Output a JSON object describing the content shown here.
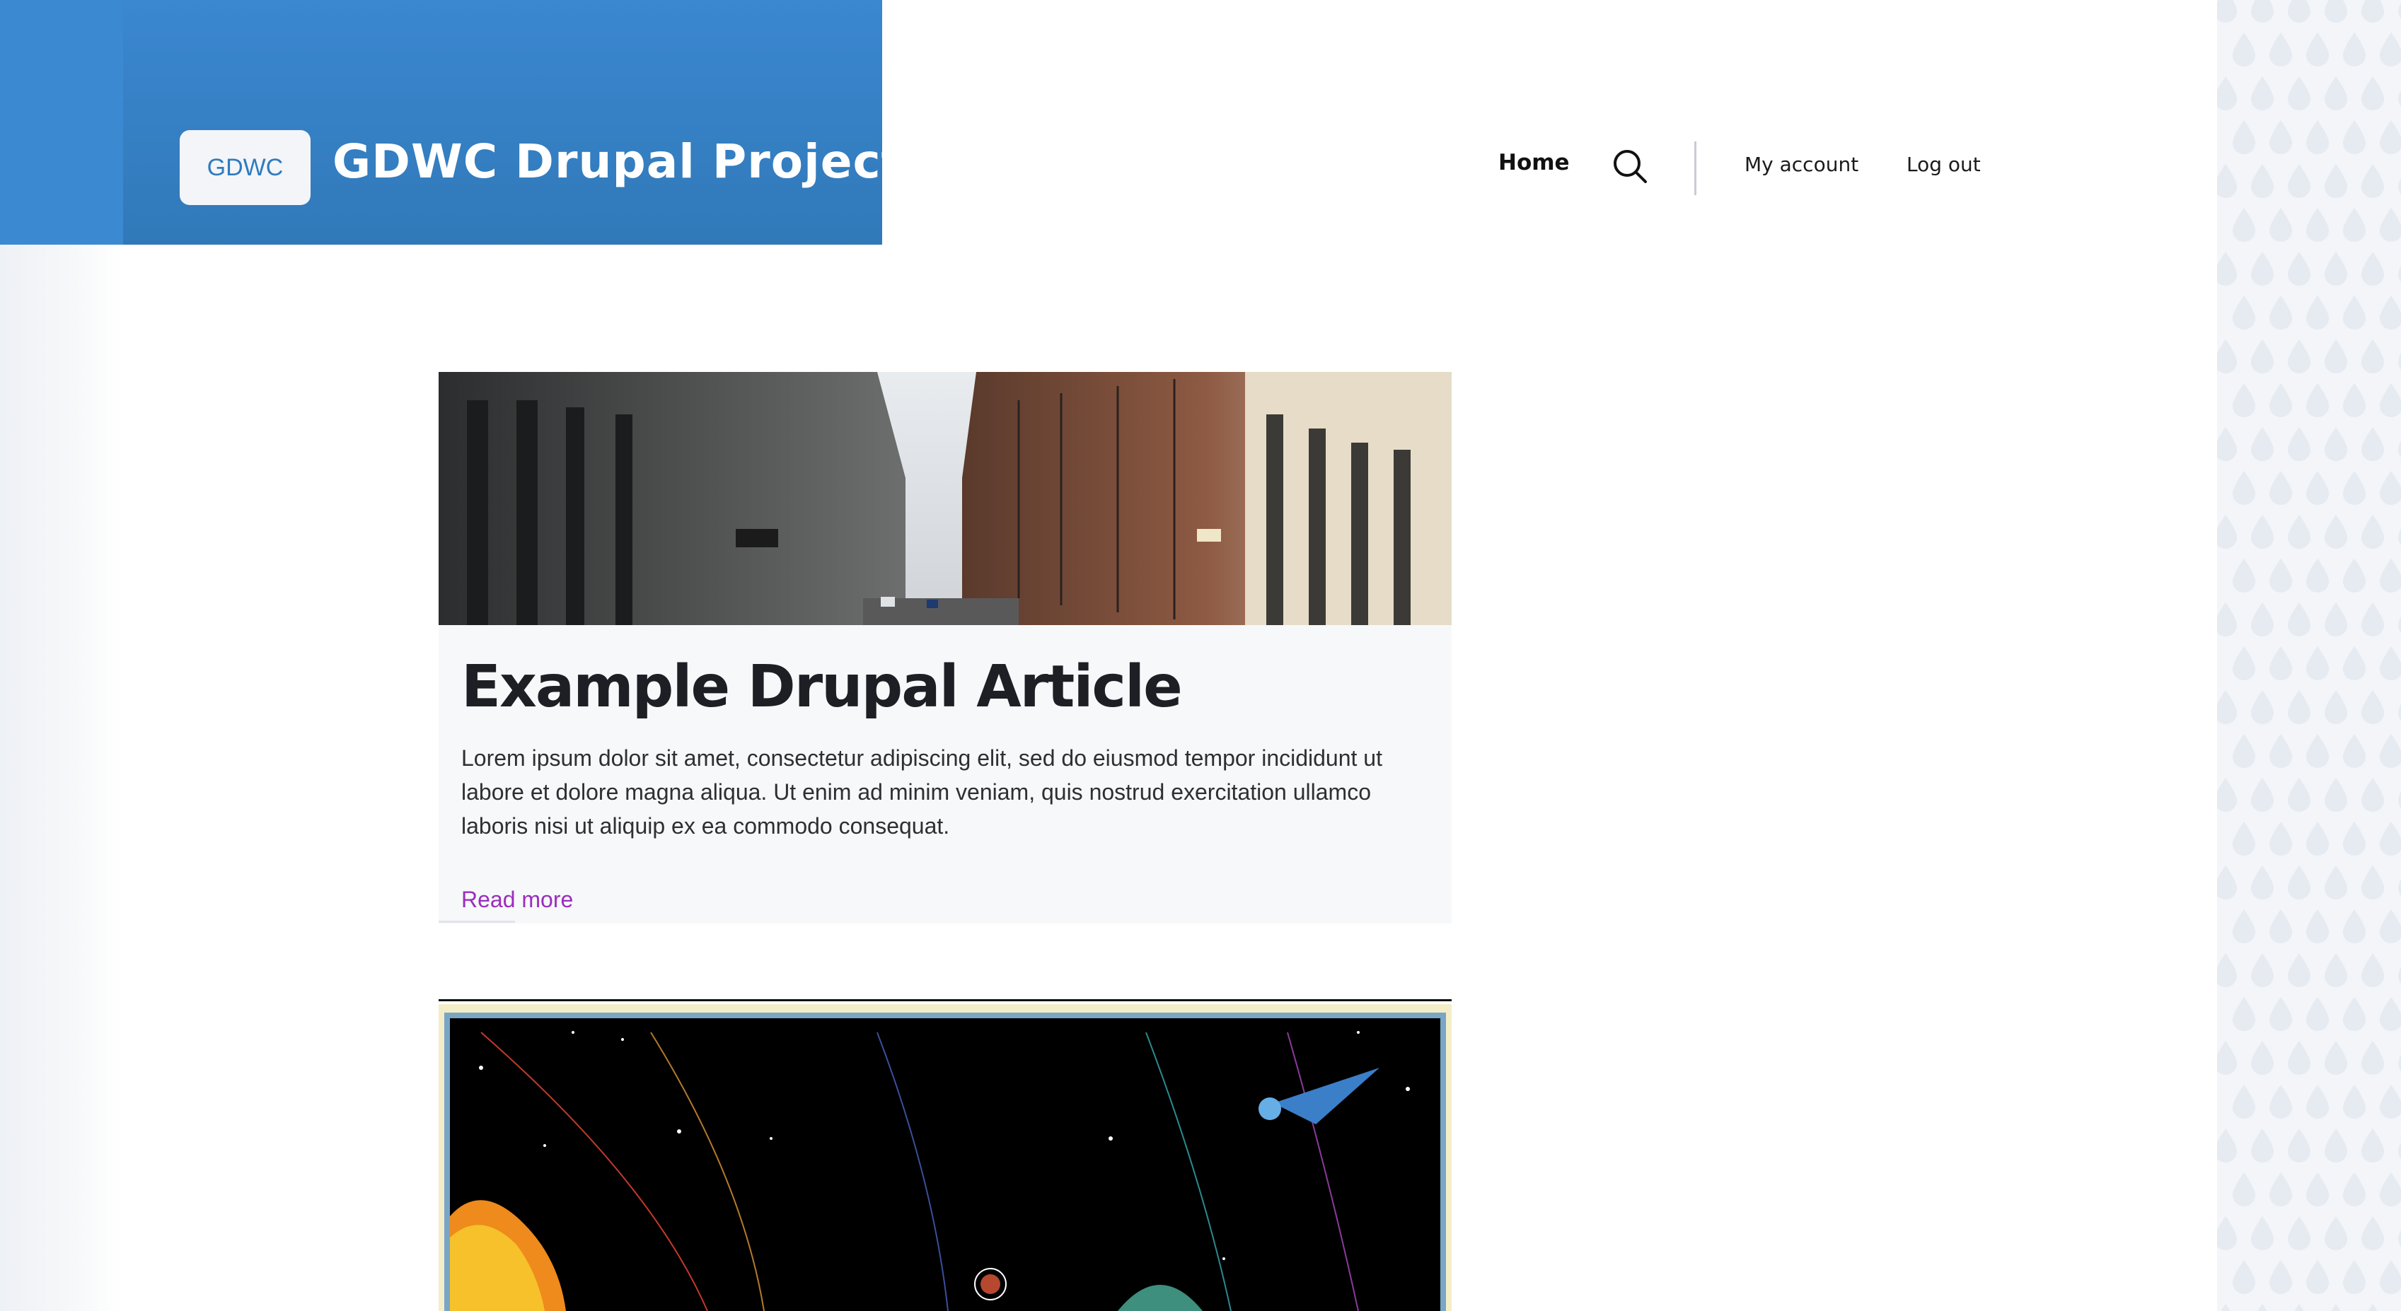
{
  "header": {
    "logo_text": "GDWC",
    "site_name": "GDWC Drupal Project"
  },
  "nav": {
    "home": "Home",
    "search_icon": "search-icon",
    "my_account": "My account",
    "log_out": "Log out"
  },
  "article": {
    "image_alt": "city street photo",
    "title": "Example Drupal Article",
    "body": "Lorem ipsum dolor sit amet, consectetur adipiscing elit, sed do eiusmod tempor incididunt ut labore et dolore magna aliqua. Ut enim ad minim veniam, quis nostrud exercitation ullamco laboris nisi ut aliquip ex ea commodo consequat.",
    "read_more": "Read more"
  },
  "second_article": {
    "image_alt": "solar system illustration"
  },
  "colors": {
    "header_blue": "#3079b9",
    "link_purple": "#9b2dbd",
    "pattern_bg": "#f3f5f9"
  }
}
